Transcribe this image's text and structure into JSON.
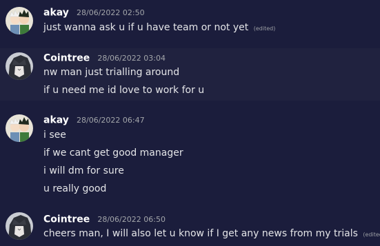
{
  "messages": [
    {
      "author": "akay",
      "time": "28/06/2022 02:50",
      "avatar": "anime-duo-avatar",
      "lines": [
        {
          "text": "just wanna ask u if u have team or not yet",
          "edited": "(edited)"
        }
      ]
    },
    {
      "author": "Cointree",
      "time": "28/06/2022 03:04",
      "avatar": "dark-anime-avatar",
      "lines": [
        {
          "text": "nw man just trialling around"
        },
        {
          "text": "if u need me id love to work for u"
        }
      ]
    },
    {
      "author": "akay",
      "time": "28/06/2022 06:47",
      "avatar": "anime-duo-avatar",
      "lines": [
        {
          "text": "i see"
        },
        {
          "text": "if we cant get good manager"
        },
        {
          "text": "i will dm for sure"
        },
        {
          "text": "u really good"
        }
      ]
    },
    {
      "author": "Cointree",
      "time": "28/06/2022 06:50",
      "avatar": "dark-anime-avatar",
      "lines": [
        {
          "text": "cheers man, I will also let u know if I get any news from my trials",
          "edited": "(edited)"
        }
      ]
    }
  ]
}
